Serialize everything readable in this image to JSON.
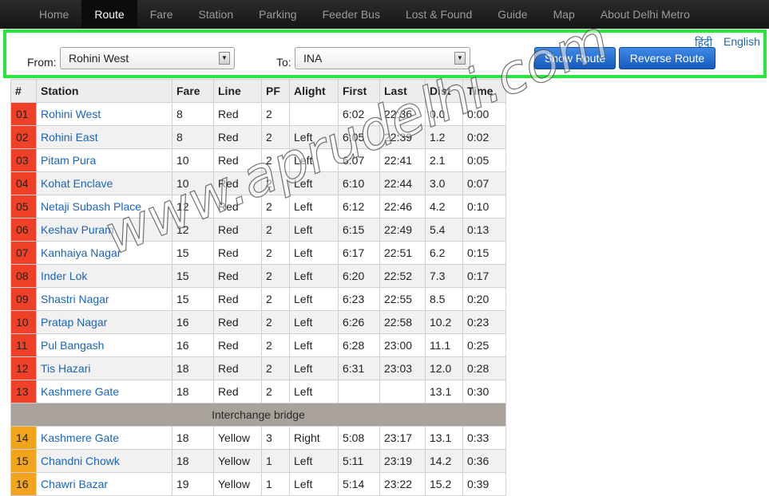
{
  "nav": [
    {
      "label": "Home",
      "name": "nav-home",
      "active": false
    },
    {
      "label": "Route",
      "name": "nav-route",
      "active": true
    },
    {
      "label": "Fare",
      "name": "nav-fare",
      "active": false
    },
    {
      "label": "Station",
      "name": "nav-station",
      "active": false
    },
    {
      "label": "Parking",
      "name": "nav-parking",
      "active": false
    },
    {
      "label": "Feeder Bus",
      "name": "nav-feeder-bus",
      "active": false
    },
    {
      "label": "Lost & Found",
      "name": "nav-lost-found",
      "active": false
    },
    {
      "label": "Guide",
      "name": "nav-guide",
      "active": false
    },
    {
      "label": "Map",
      "name": "nav-map",
      "active": false
    },
    {
      "label": "About Delhi Metro",
      "name": "nav-about",
      "active": false
    }
  ],
  "lang": {
    "hindi": "हिंदी",
    "english": "English"
  },
  "form": {
    "from_label": "From:",
    "from_value": "Rohini West",
    "to_label": "To:",
    "to_value": "INA",
    "show_button": "Show Route",
    "reverse_button": "Reverse Route",
    "dropdown_icon": "triangle-down-icon"
  },
  "colors": {
    "red_line": "#ee4127",
    "yellow_line": "#f2a41d",
    "highlight": "#27e63a",
    "link": "#1a64b8"
  },
  "table": {
    "headers": [
      "#",
      "Station",
      "Fare",
      "Line",
      "PF",
      "Alight",
      "First",
      "Last",
      "Dist",
      "Time"
    ],
    "rows": [
      [
        "01",
        "Rohini West",
        "8",
        "Red",
        "2",
        "",
        "6:02",
        "22:36",
        "0.0",
        "0:00"
      ],
      [
        "02",
        "Rohini East",
        "8",
        "Red",
        "2",
        "Left",
        "6:05",
        "22:39",
        "1.2",
        "0:02"
      ],
      [
        "03",
        "Pitam Pura",
        "10",
        "Red",
        "2",
        "Left",
        "6:07",
        "22:41",
        "2.1",
        "0:05"
      ],
      [
        "04",
        "Kohat Enclave",
        "10",
        "Red",
        "2",
        "Left",
        "6:10",
        "22:44",
        "3.0",
        "0:07"
      ],
      [
        "05",
        "Netaji Subash Place",
        "12",
        "Red",
        "2",
        "Left",
        "6:12",
        "22:46",
        "4.2",
        "0:10"
      ],
      [
        "06",
        "Keshav Puram",
        "12",
        "Red",
        "2",
        "Left",
        "6:15",
        "22:49",
        "5.4",
        "0:13"
      ],
      [
        "07",
        "Kanhaiya Nagar",
        "15",
        "Red",
        "2",
        "Left",
        "6:17",
        "22:51",
        "6.2",
        "0:15"
      ],
      [
        "08",
        "Inder Lok",
        "15",
        "Red",
        "2",
        "Left",
        "6:20",
        "22:52",
        "7.3",
        "0:17"
      ],
      [
        "09",
        "Shastri Nagar",
        "15",
        "Red",
        "2",
        "Left",
        "6:23",
        "22:55",
        "8.5",
        "0:20"
      ],
      [
        "10",
        "Pratap Nagar",
        "16",
        "Red",
        "2",
        "Left",
        "6:26",
        "22:58",
        "10.2",
        "0:23"
      ],
      [
        "11",
        "Pul Bangash",
        "16",
        "Red",
        "2",
        "Left",
        "6:28",
        "23:00",
        "11.1",
        "0:25"
      ],
      [
        "12",
        "Tis Hazari",
        "18",
        "Red",
        "2",
        "Left",
        "6:31",
        "23:03",
        "12.0",
        "0:28"
      ],
      [
        "13",
        "Kashmere Gate",
        "18",
        "Red",
        "2",
        "Left",
        "",
        "",
        "13.1",
        "0:30"
      ],
      {
        "bridge": "Interchange bridge"
      },
      [
        "14",
        "Kashmere Gate",
        "18",
        "Yellow",
        "3",
        "Right",
        "5:08",
        "23:17",
        "13.1",
        "0:33"
      ],
      [
        "15",
        "Chandni Chowk",
        "18",
        "Yellow",
        "1",
        "Left",
        "5:11",
        "23:19",
        "14.2",
        "0:36"
      ],
      [
        "16",
        "Chawri Bazar",
        "19",
        "Yellow",
        "1",
        "Left",
        "5:14",
        "23:22",
        "15.2",
        "0:39"
      ]
    ]
  },
  "watermark": "www.aprudelhi.com"
}
